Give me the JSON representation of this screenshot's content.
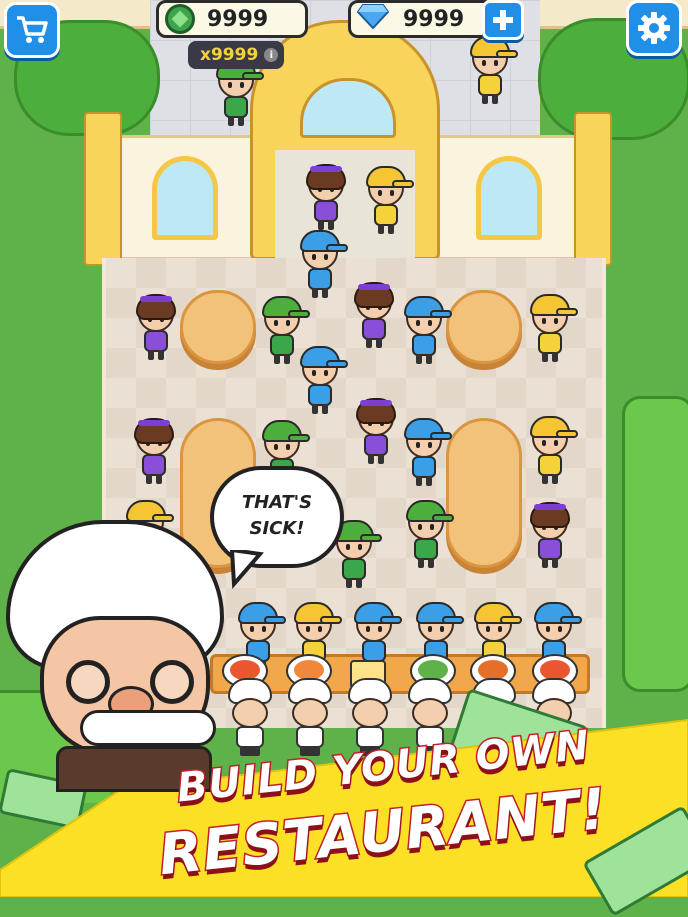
{
  "hud": {
    "cash_value": "9999",
    "gems_value": "9999",
    "multiplier": "x9999",
    "info_glyph": "i"
  },
  "speech": {
    "line1": "THAT'S",
    "line2": "SICK!"
  },
  "banner": {
    "line1": "BUILD YOUR OWN",
    "line2": "RESTAURANT!"
  },
  "icons": {
    "shop": "shopping-cart-icon",
    "cash": "cash-icon",
    "gem": "gem-icon",
    "add": "plus-icon",
    "settings": "gear-icon"
  },
  "colors": {
    "button_blue": "#1f8fe8",
    "banner_yellow": "#fbe025",
    "banner_red": "#c1202a",
    "table": "#f3c27a",
    "grass": "#5fb24a"
  }
}
